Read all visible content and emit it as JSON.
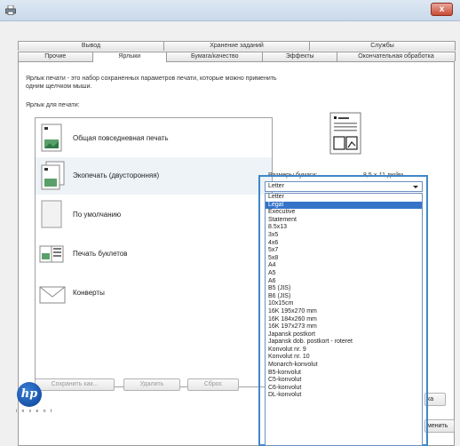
{
  "window": {
    "close_label": "x"
  },
  "tabs_top": [
    "Вывод",
    "Хранение заданий",
    "Службы"
  ],
  "tabs_bottom": [
    "Прочие",
    "Ярлыки",
    "Бумага/качество",
    "Эффекты",
    "Окончательная обработка"
  ],
  "active_tab": "Ярлыки",
  "description": "Ярлык печати - это набор сохраненных параметров печати, которые можно применить одним щелчком мыши.",
  "list_label": "Ярлык для печати:",
  "presets": [
    "Общая повседневная печать",
    "Экопечать (двусторонняя)",
    "По умолчанию",
    "Печать буклетов",
    "Конверты"
  ],
  "selected_preset": "Экопечать (двусторонняя)",
  "buttons": {
    "save_as": "Сохранить как...",
    "delete": "Удалить",
    "reset": "Сброс"
  },
  "brand": {
    "logo": "hp",
    "tagline": "i n v e n t"
  },
  "paper": {
    "label": "Размеры бумаги:",
    "size": "8,5 × 11 дюйм.",
    "selected": "Letter",
    "highlighted": "Legal",
    "options": [
      "Letter",
      "Legal",
      "Executive",
      "Statement",
      "8.5x13",
      "3x5",
      "4x6",
      "5x7",
      "5x8",
      "A4",
      "A5",
      "A6",
      "B5 (JIS)",
      "B6 (JIS)",
      "10x15cm",
      "16K 195x270 mm",
      "16K 184x260 mm",
      "16K 197x273 mm",
      "Japansk postkort",
      "Japansk dob. postkort - roteret",
      "Konvolut nr. 9",
      "Konvolut nr. 10",
      "Monarch-konvolut",
      "B5-konvolut",
      "C5-konvolut",
      "C6-konvolut",
      "DL-konvolut"
    ]
  },
  "partial_buttons": {
    "side_partial": "ка",
    "bottom_partial": "менить"
  },
  "colors": {
    "accent": "#3f87c8",
    "highlight": "#3574c9",
    "close": "#c94a35"
  }
}
